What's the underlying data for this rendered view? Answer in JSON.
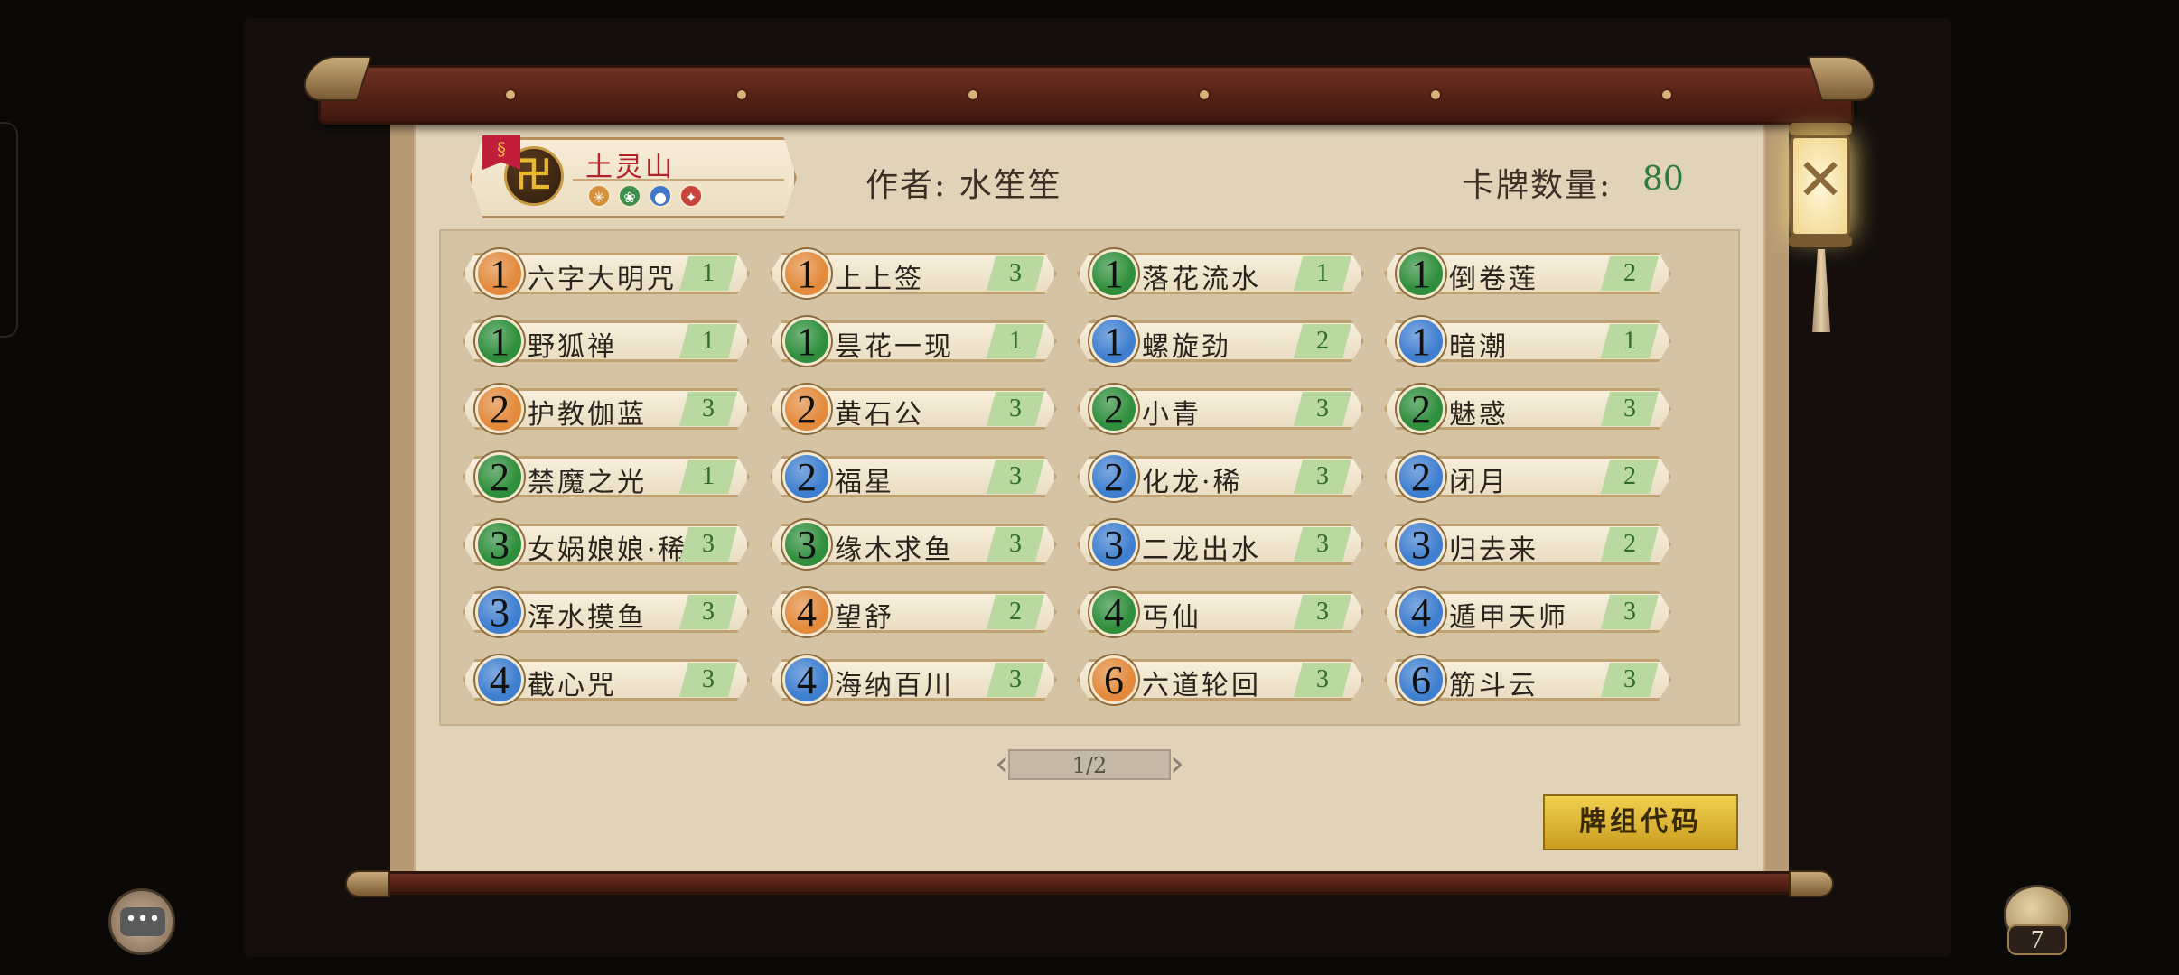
{
  "deck": {
    "name": "土灵山",
    "emblem_glyph": "卍",
    "ribbon_glyph": "§",
    "elements": [
      {
        "icon": "sun-element-icon",
        "glyph": "✳",
        "color": "#d7903a"
      },
      {
        "icon": "wood-element-icon",
        "glyph": "❀",
        "color": "#3f8f4a"
      },
      {
        "icon": "water-element-icon",
        "glyph": "●",
        "color": "#3f78c8"
      },
      {
        "icon": "fire-element-icon",
        "glyph": "✦",
        "color": "#c8443a"
      }
    ],
    "author_label": "作者: 水笙笙",
    "count_label": "卡牌数量:",
    "count_value": "80"
  },
  "cost_colors": {
    "orange": "#e38a3c",
    "green": "#2f8f3c",
    "blue": "#3f7fd0"
  },
  "cards": [
    {
      "cost": "1",
      "color": "orange",
      "name": "六字大明咒",
      "qty": "1"
    },
    {
      "cost": "1",
      "color": "orange",
      "name": "上上签",
      "qty": "3"
    },
    {
      "cost": "1",
      "color": "green",
      "name": "落花流水",
      "qty": "1"
    },
    {
      "cost": "1",
      "color": "green",
      "name": "倒卷莲",
      "qty": "2"
    },
    {
      "cost": "1",
      "color": "green",
      "name": "野狐禅",
      "qty": "1"
    },
    {
      "cost": "1",
      "color": "green",
      "name": "昙花一现",
      "qty": "1"
    },
    {
      "cost": "1",
      "color": "blue",
      "name": "螺旋劲",
      "qty": "2"
    },
    {
      "cost": "1",
      "color": "blue",
      "name": "暗潮",
      "qty": "1"
    },
    {
      "cost": "2",
      "color": "orange",
      "name": "护教伽蓝",
      "qty": "3"
    },
    {
      "cost": "2",
      "color": "orange",
      "name": "黄石公",
      "qty": "3"
    },
    {
      "cost": "2",
      "color": "green",
      "name": "小青",
      "qty": "3"
    },
    {
      "cost": "2",
      "color": "green",
      "name": "魅惑",
      "qty": "3"
    },
    {
      "cost": "2",
      "color": "green",
      "name": "禁魔之光",
      "qty": "1"
    },
    {
      "cost": "2",
      "color": "blue",
      "name": "福星",
      "qty": "3"
    },
    {
      "cost": "2",
      "color": "blue",
      "name": "化龙·稀",
      "qty": "3"
    },
    {
      "cost": "2",
      "color": "blue",
      "name": "闭月",
      "qty": "2"
    },
    {
      "cost": "3",
      "color": "green",
      "name": "女娲娘娘·稀",
      "qty": "3"
    },
    {
      "cost": "3",
      "color": "green",
      "name": "缘木求鱼",
      "qty": "3"
    },
    {
      "cost": "3",
      "color": "blue",
      "name": "二龙出水",
      "qty": "3"
    },
    {
      "cost": "3",
      "color": "blue",
      "name": "归去来",
      "qty": "2"
    },
    {
      "cost": "3",
      "color": "blue",
      "name": "浑水摸鱼",
      "qty": "3"
    },
    {
      "cost": "4",
      "color": "orange",
      "name": "望舒",
      "qty": "2"
    },
    {
      "cost": "4",
      "color": "green",
      "name": "丐仙",
      "qty": "3"
    },
    {
      "cost": "4",
      "color": "blue",
      "name": "遁甲天师",
      "qty": "3"
    },
    {
      "cost": "4",
      "color": "blue",
      "name": "截心咒",
      "qty": "3"
    },
    {
      "cost": "4",
      "color": "blue",
      "name": "海纳百川",
      "qty": "3"
    },
    {
      "cost": "6",
      "color": "orange",
      "name": "六道轮回",
      "qty": "3"
    },
    {
      "cost": "6",
      "color": "blue",
      "name": "筋斗云",
      "qty": "3"
    }
  ],
  "pager": {
    "label": "1/2",
    "prev_glyph": "‹",
    "next_glyph": "›"
  },
  "deck_code_button": "牌组代码",
  "close_glyph": "✕",
  "chat_glyph": "•••",
  "bag_count": "7"
}
